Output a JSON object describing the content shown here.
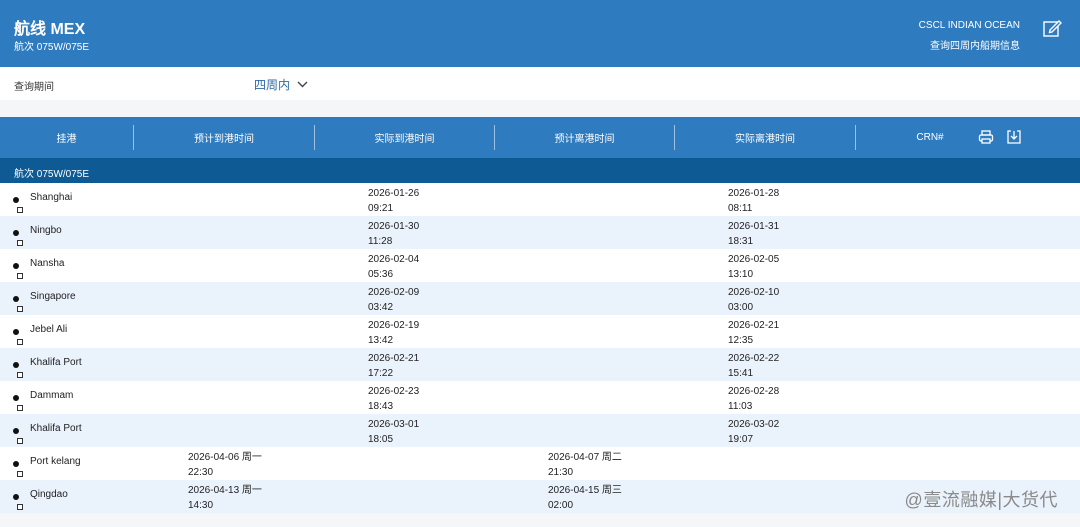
{
  "header": {
    "title": "航线 MEX",
    "voyage": "航次 075W/075E",
    "vessel": "CSCL INDIAN OCEAN",
    "subtitle_right": "查询四周内船期信息"
  },
  "filter": {
    "label": "查询期间",
    "value": "四周内"
  },
  "table": {
    "columns": [
      "挂港",
      "预计到港时间",
      "实际到港时间",
      "预计离港时间",
      "实际离港时间",
      "CRN#"
    ],
    "group_label": "航次 075W/075E",
    "rows": [
      {
        "port": "Shanghai",
        "eta": "",
        "ata": "2026-01-26\n09:21",
        "etd": "",
        "atd": "2026-01-28\n08:11"
      },
      {
        "port": "Ningbo",
        "eta": "",
        "ata": "2026-01-30\n11:28",
        "etd": "",
        "atd": "2026-01-31\n18:31"
      },
      {
        "port": "Nansha",
        "eta": "",
        "ata": "2026-02-04\n05:36",
        "etd": "",
        "atd": "2026-02-05\n13:10"
      },
      {
        "port": "Singapore",
        "eta": "",
        "ata": "2026-02-09\n03:42",
        "etd": "",
        "atd": "2026-02-10\n03:00"
      },
      {
        "port": "Jebel Ali",
        "eta": "",
        "ata": "2026-02-19\n13:42",
        "etd": "",
        "atd": "2026-02-21\n12:35"
      },
      {
        "port": "Khalifa Port",
        "eta": "",
        "ata": "2026-02-21\n17:22",
        "etd": "",
        "atd": "2026-02-22\n15:41"
      },
      {
        "port": "Dammam",
        "eta": "",
        "ata": "2026-02-23\n18:43",
        "etd": "",
        "atd": "2026-02-28\n11:03"
      },
      {
        "port": "Khalifa Port",
        "eta": "",
        "ata": "2026-03-01\n18:05",
        "etd": "",
        "atd": "2026-03-02\n19:07"
      },
      {
        "port": "Port kelang",
        "eta": "2026-04-06 周一\n22:30",
        "ata": "",
        "etd": "2026-04-07 周二\n21:30",
        "atd": ""
      },
      {
        "port": "Qingdao",
        "eta": "2026-04-13 周一\n14:30",
        "ata": "",
        "etd": "2026-04-15 周三\n02:00",
        "atd": ""
      }
    ]
  },
  "watermark": "@壹流融媒|大货代",
  "icons": {
    "edit": "edit-icon",
    "print": "print-icon",
    "download": "download-icon",
    "chevron": "chevron-down-icon"
  }
}
